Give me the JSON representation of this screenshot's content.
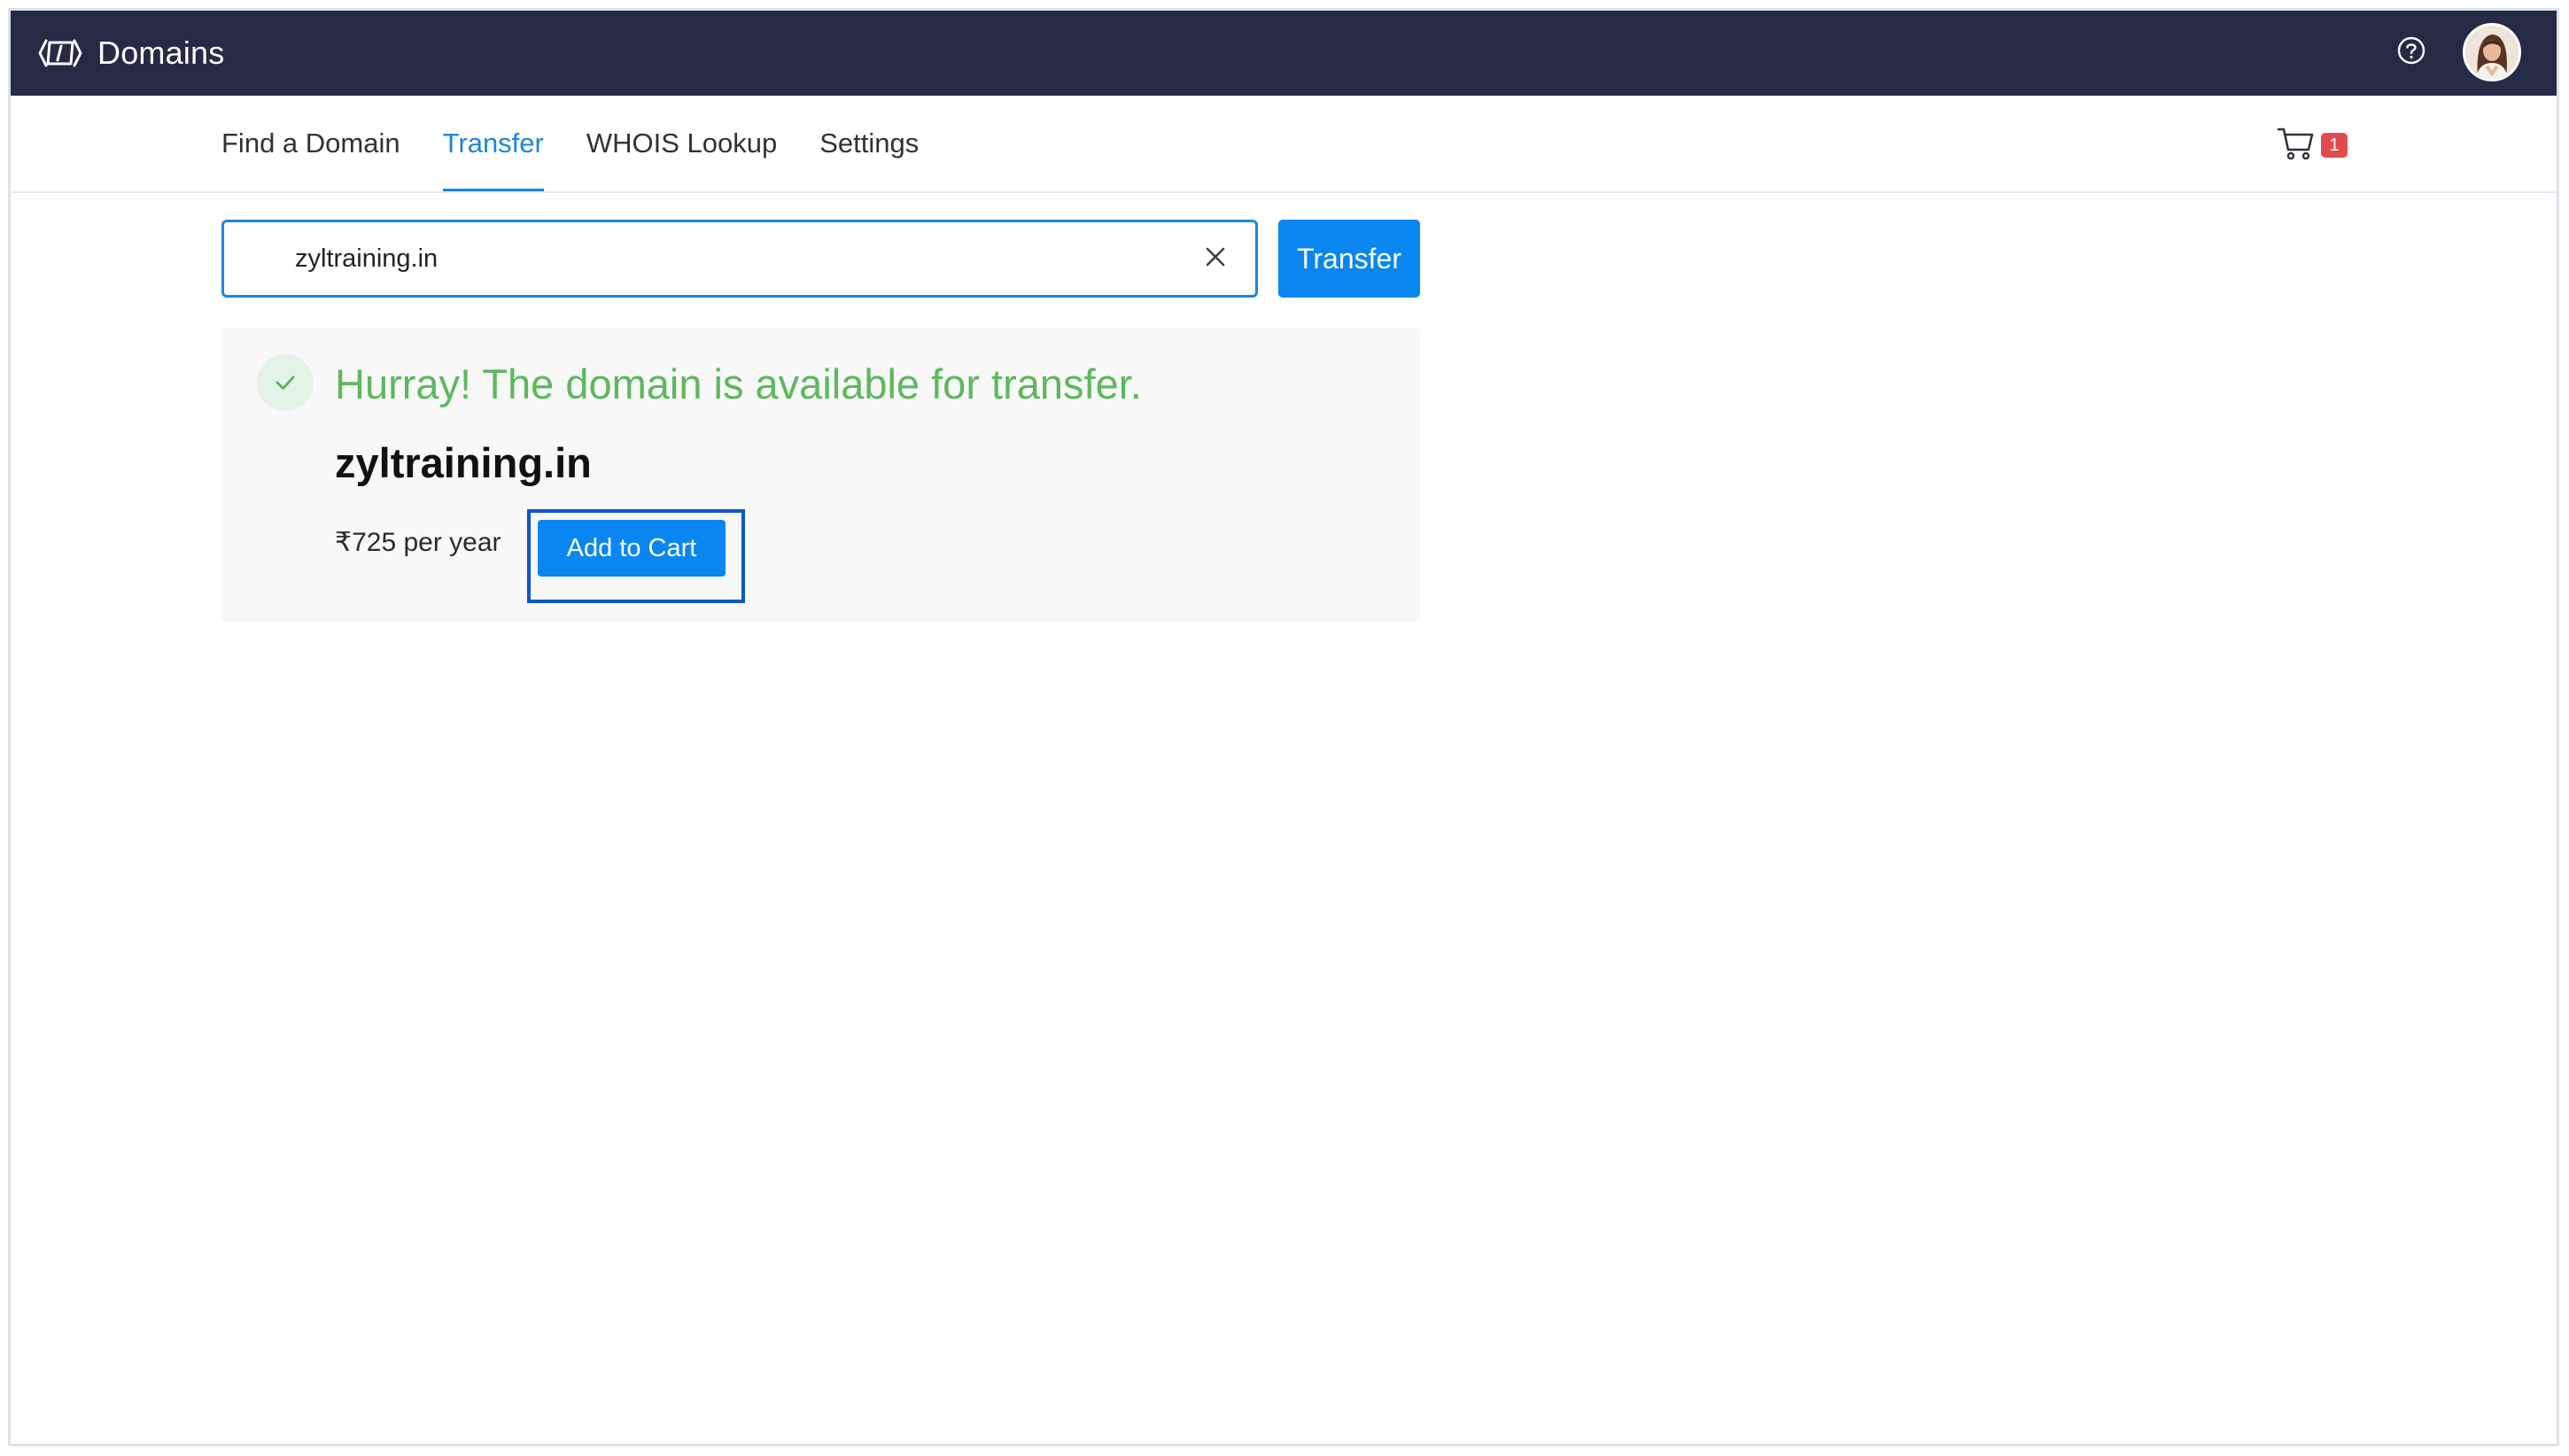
{
  "app": {
    "title": "Domains",
    "logo_icon": "domains-logo-icon",
    "help_icon": "help-circle-icon",
    "avatar_icon": "user-avatar"
  },
  "nav": {
    "tabs": [
      {
        "label": "Find a Domain",
        "active": false
      },
      {
        "label": "Transfer",
        "active": true
      },
      {
        "label": "WHOIS Lookup",
        "active": false
      },
      {
        "label": "Settings",
        "active": false
      }
    ],
    "cart_icon": "shopping-cart-icon",
    "cart_count": "1"
  },
  "search": {
    "value": "zyltraining.in",
    "clear_icon": "close-icon",
    "button_label": "Transfer"
  },
  "result": {
    "status_icon": "check-icon",
    "message": "Hurray! The domain is available for transfer.",
    "domain": "zyltraining.in",
    "price": "₹725 per year",
    "add_to_cart_label": "Add to Cart"
  },
  "colors": {
    "topbar_bg": "#252a45",
    "accent": "#1b86e0",
    "button": "#0a86f0",
    "success": "#5cb85c",
    "badge": "#e04b4b",
    "highlight": "#0f56c6"
  }
}
